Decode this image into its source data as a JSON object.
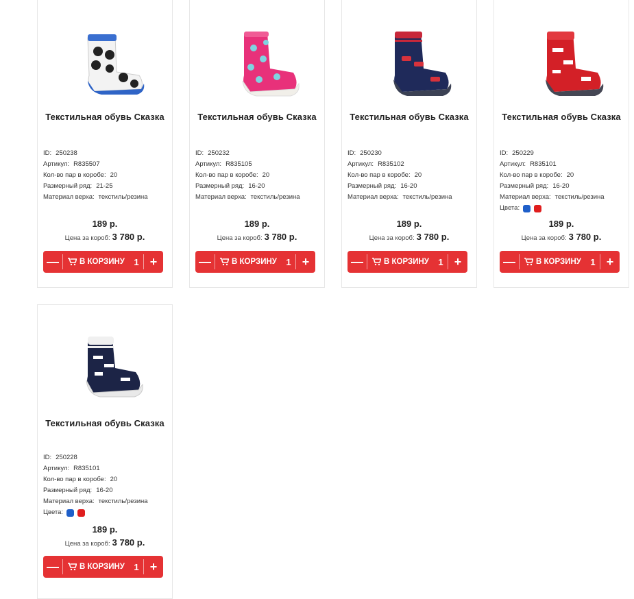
{
  "labels": {
    "id": "ID:",
    "article": "Артикул:",
    "pairs": "Кол-во пар в коробе:",
    "size": "Размерный ряд:",
    "material": "Материал верха:",
    "colors": "Цвета:",
    "box_price": "Цена за короб:",
    "cart_button": "В КОРЗИНУ",
    "minus": "—",
    "plus": "+"
  },
  "products": [
    {
      "title": "Текстильная обувь Сказка",
      "id": "250238",
      "article": "R835507",
      "pairs": "20",
      "size": "21-25",
      "material": "текстиль/резина",
      "price": "189 р.",
      "box_price": "3 780 р.",
      "qty": "1",
      "colors": [],
      "image": "sock-soccer-blue"
    },
    {
      "title": "Текстильная обувь Сказка",
      "id": "250232",
      "article": "R835105",
      "pairs": "20",
      "size": "16-20",
      "material": "текстиль/резина",
      "price": "189 р.",
      "box_price": "3 780 р.",
      "qty": "1",
      "colors": [],
      "image": "sock-pink-dots"
    },
    {
      "title": "Текстильная обувь Сказка",
      "id": "250230",
      "article": "R835102",
      "pairs": "20",
      "size": "16-20",
      "material": "текстиль/резина",
      "price": "189 р.",
      "box_price": "3 780 р.",
      "qty": "1",
      "colors": [],
      "image": "sock-navy-cars"
    },
    {
      "title": "Текстильная обувь Сказка",
      "id": "250229",
      "article": "R835101",
      "pairs": "20",
      "size": "16-20",
      "material": "текстиль/резина",
      "price": "189 р.",
      "box_price": "3 780 р.",
      "qty": "1",
      "colors": [
        "#1f5fc9",
        "#e01e1e"
      ],
      "image": "sock-red-print"
    },
    {
      "title": "Текстильная обувь Сказка",
      "id": "250228",
      "article": "R835101",
      "pairs": "20",
      "size": "16-20",
      "material": "текстиль/резина",
      "price": "189 р.",
      "box_price": "3 780 р.",
      "qty": "1",
      "colors": [
        "#1f5fc9",
        "#e01e1e"
      ],
      "image": "sock-navy-print"
    }
  ],
  "theme": {
    "accent": "#e53234"
  }
}
